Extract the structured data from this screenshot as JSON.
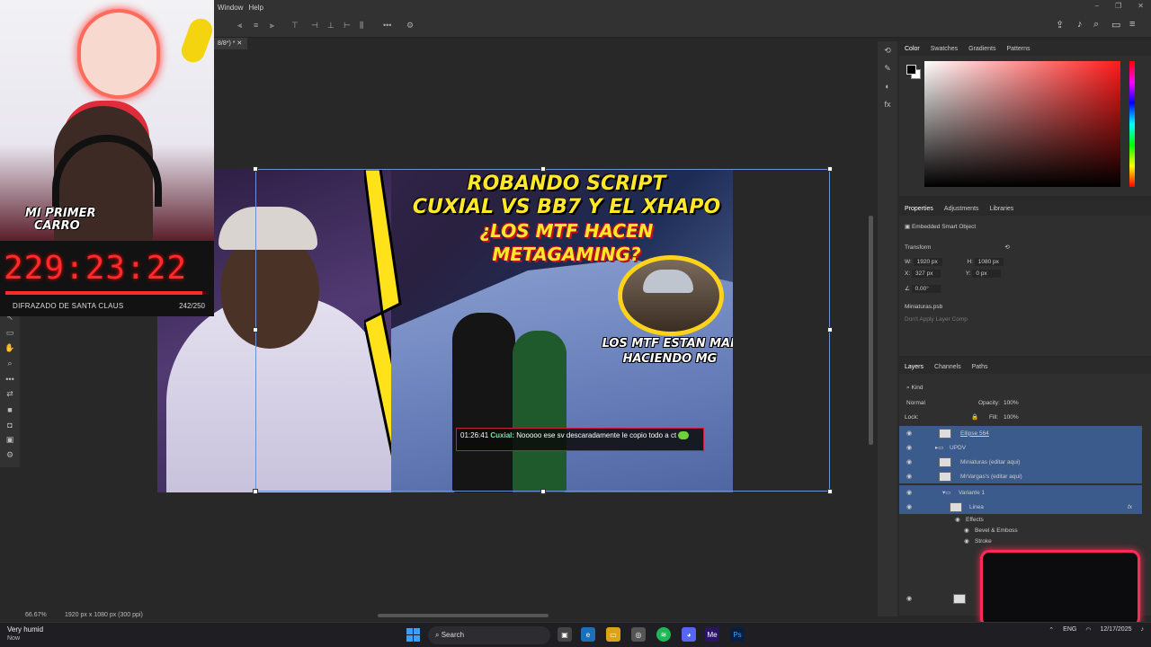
{
  "menu": {
    "items": [
      "Window",
      "Help"
    ]
  },
  "document": {
    "tab_label": "8/8*) *",
    "zoom": "66.67%",
    "doc_info": "1920 px x 1080 px (300 ppi)"
  },
  "thumbnail": {
    "title_line1": "ROBANDO SCRIPT",
    "title_line2": "CUXIAL VS BB7 Y EL XHAPO",
    "title_line3": "¿LOS MTF HACEN METAGAMING?",
    "circle_caption": "LOS MTF ESTAN MAL HACIENDO MG",
    "chat_time": "01:26:41",
    "chat_user": "Cuxial:",
    "chat_message": "Nooooo ese sv descaradamente le copio todo a ct"
  },
  "color_panel": {
    "tabs": [
      "Color",
      "Swatches",
      "Gradients",
      "Patterns"
    ],
    "fg_color": "#000000",
    "bg_color": "#ffffff"
  },
  "properties_panel": {
    "tabs": [
      "Properties",
      "Adjustments",
      "Libraries"
    ],
    "type": "Embedded Smart Object",
    "transform_label": "Transform",
    "w": "1920 px",
    "h": "1080 px",
    "x": "327 px",
    "y": "0 px",
    "angle": "0.00°",
    "file": "Miniaturas.psb",
    "layer_comp": "Don't Apply Layer Comp"
  },
  "layers_panel": {
    "tabs": [
      "Layers",
      "Channels",
      "Paths"
    ],
    "kind": "Kind",
    "blend_mode": "Normal",
    "opacity_label": "Opacity:",
    "opacity": "100%",
    "lock_label": "Lock:",
    "fill_label": "Fill:",
    "fill": "100%",
    "layers": [
      {
        "name": "Ellipse 564",
        "indent": 0
      },
      {
        "name": "UPDV",
        "indent": 0
      },
      {
        "name": "Miniaturas (editar aqui)",
        "indent": 1
      },
      {
        "name": "MrVargas's (editar aqui)",
        "indent": 1
      },
      {
        "name": "Variante 1",
        "indent": 1
      },
      {
        "name": "Linea",
        "indent": 2
      },
      {
        "name": "Effects",
        "indent": 3
      },
      {
        "name": "Bevel & Emboss",
        "indent": 4
      },
      {
        "name": "Stroke",
        "indent": 4
      }
    ]
  },
  "stream": {
    "badge_line1": "MI PRIMER",
    "badge_line2": "CARRO",
    "timer": "229:23:22",
    "goal_label": "DIFRAZADO DE SANTA CLAUS",
    "goal_count": "242/250",
    "goal_progress": 0.968
  },
  "taskbar": {
    "weather_title": "Very humid",
    "weather_sub": "Now",
    "search_label": "Search",
    "lang": "ENG",
    "date": "12/17/2025",
    "accent": "#3aa0ff"
  }
}
